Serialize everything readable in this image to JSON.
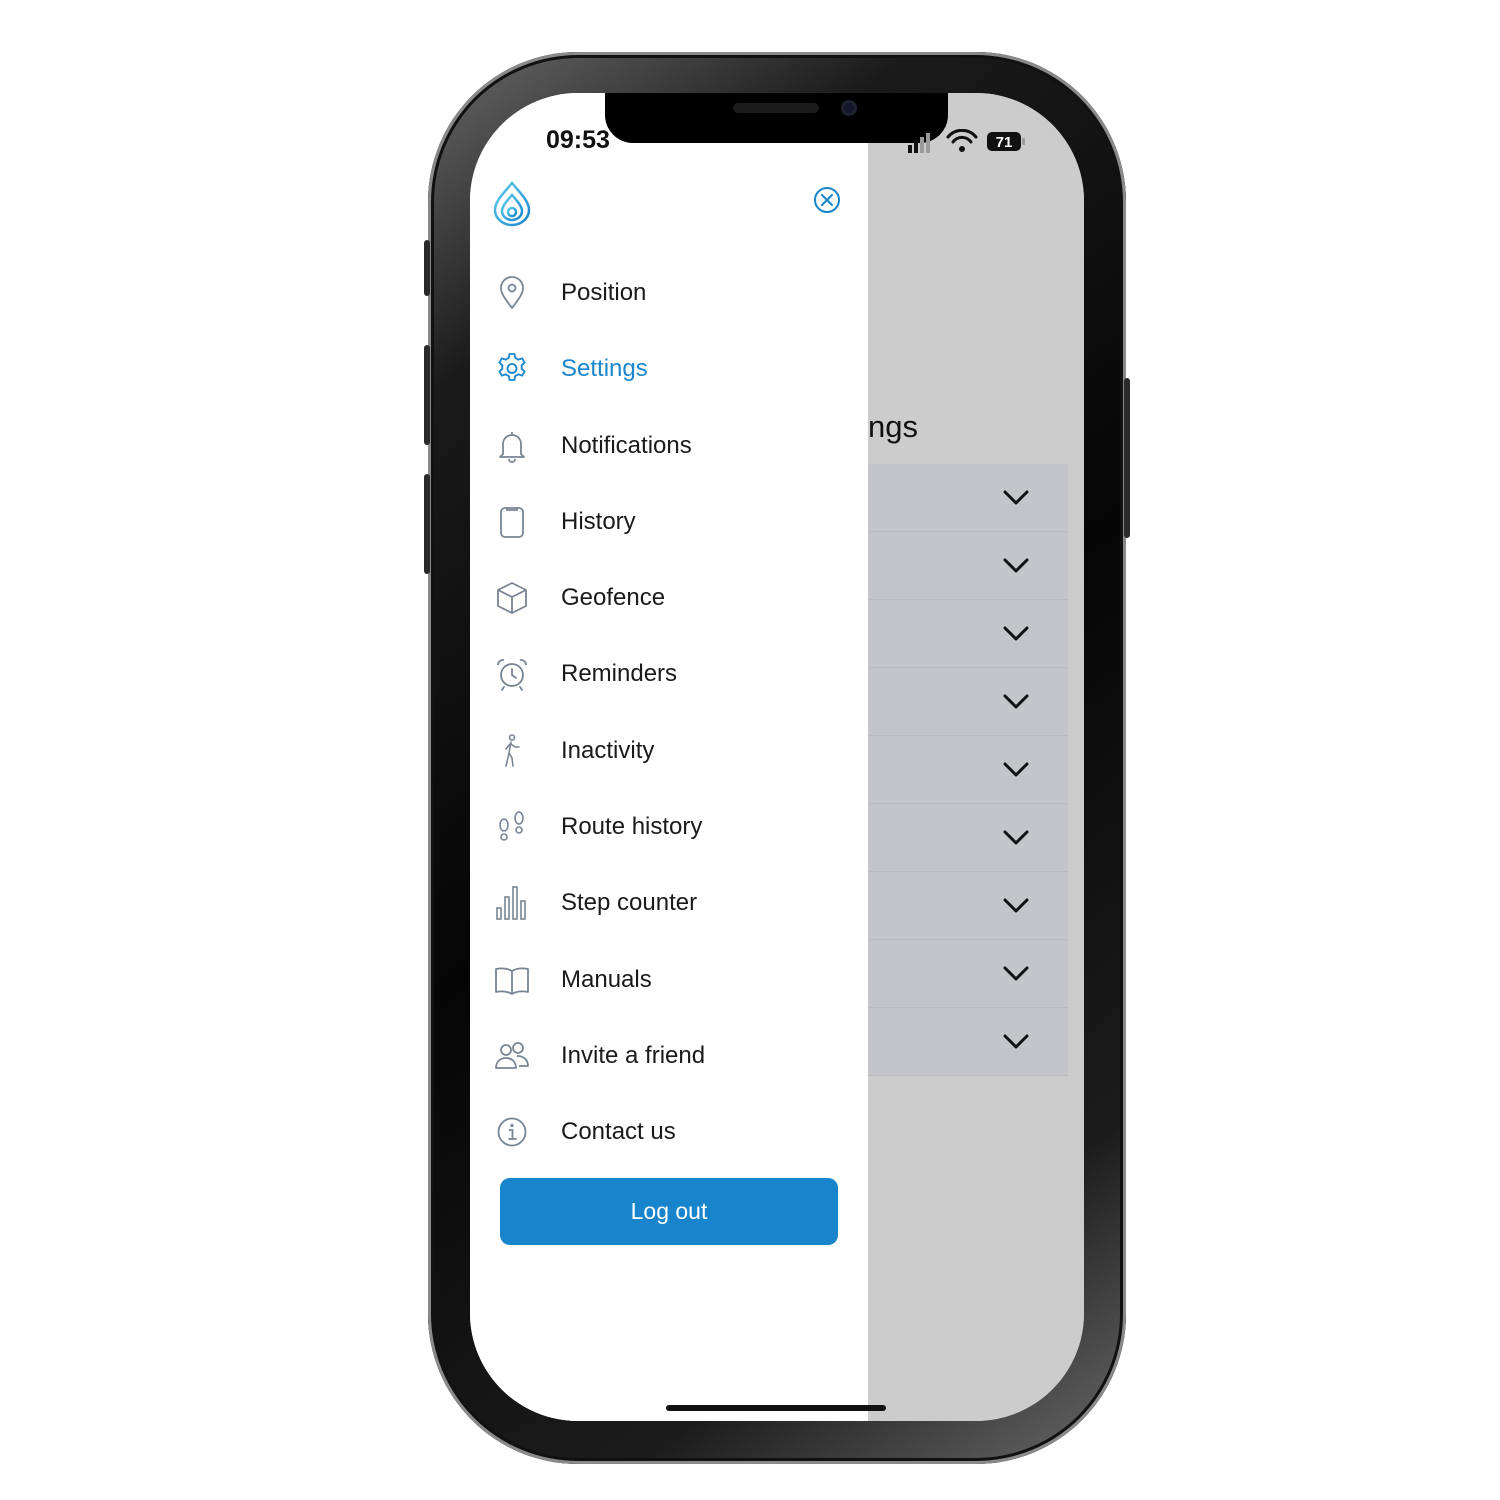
{
  "status_bar": {
    "time": "09:53",
    "battery": "71"
  },
  "drawer": {
    "menu": [
      {
        "label": "Position",
        "icon": "map-pin-icon",
        "active": false
      },
      {
        "label": "Settings",
        "icon": "gear-icon",
        "active": true
      },
      {
        "label": "Notifications",
        "icon": "bell-icon",
        "active": false
      },
      {
        "label": "History",
        "icon": "clipboard-icon",
        "active": false
      },
      {
        "label": "Geofence",
        "icon": "cube-icon",
        "active": false
      },
      {
        "label": "Reminders",
        "icon": "alarm-clock-icon",
        "active": false
      },
      {
        "label": "Inactivity",
        "icon": "walking-person-icon",
        "active": false
      },
      {
        "label": "Route history",
        "icon": "footprints-icon",
        "active": false
      },
      {
        "label": "Step counter",
        "icon": "bar-chart-icon",
        "active": false
      },
      {
        "label": "Manuals",
        "icon": "open-book-icon",
        "active": false
      },
      {
        "label": "Invite a friend",
        "icon": "users-icon",
        "active": false
      },
      {
        "label": "Contact us",
        "icon": "info-icon",
        "active": false
      }
    ],
    "logout_label": "Log out"
  },
  "background_page": {
    "title_fragment": "ngs",
    "row_count": 9
  },
  "colors": {
    "accent": "#1784cc",
    "overlay": "#cccccc",
    "icon_gray": "#7a8593"
  }
}
